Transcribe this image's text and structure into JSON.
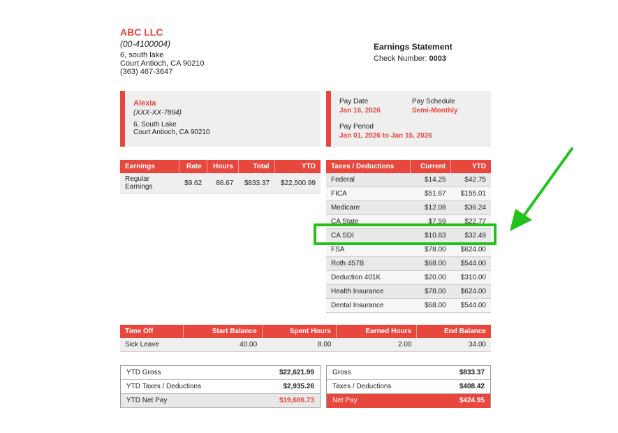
{
  "company": {
    "name": "ABC LLC",
    "id": "(00-4100004)",
    "address1": "6, south lake",
    "address2": "Court Antioch, CA 90210",
    "phone": "(363) 467-3647"
  },
  "statement": {
    "title": "Earnings Statement",
    "check_label": "Check Number:",
    "check_number": "0003"
  },
  "employee": {
    "name": "Alexia",
    "ssn": "(XXX-XX-7894)",
    "address1": "6, South Lake",
    "address2": "Court Antioch, CA 90210"
  },
  "pay_info": {
    "pay_date_label": "Pay Date",
    "pay_date": "Jan 16, 2026",
    "schedule_label": "Pay Schedule",
    "schedule": "Semi-Monthly",
    "period_label": "Pay Period",
    "period": "Jan 01, 2026 to Jan 15, 2026"
  },
  "earnings": {
    "headers": [
      "Earnings",
      "Rate",
      "Hours",
      "Total",
      "YTD"
    ],
    "rows": [
      {
        "name": "Regular Earnings",
        "rate": "$9.62",
        "hours": "86.67",
        "total": "$833.37",
        "ytd": "$22,500.99"
      }
    ]
  },
  "taxes": {
    "headers": [
      "Taxes / Deductions",
      "Current",
      "YTD"
    ],
    "rows": [
      {
        "name": "Federal",
        "current": "$14.25",
        "ytd": "$42.75"
      },
      {
        "name": "FICA",
        "current": "$51.67",
        "ytd": "$155.01"
      },
      {
        "name": "Medicare",
        "current": "$12.08",
        "ytd": "$36.24"
      },
      {
        "name": "CA State",
        "current": "$7.59",
        "ytd": "$22.77"
      },
      {
        "name": "CA SDI",
        "current": "$10.83",
        "ytd": "$32.49"
      },
      {
        "name": "FSA",
        "current": "$78.00",
        "ytd": "$624.00"
      },
      {
        "name": "Roth 457B",
        "current": "$68.00",
        "ytd": "$544.00"
      },
      {
        "name": "Deduction 401K",
        "current": "$20.00",
        "ytd": "$310.00"
      },
      {
        "name": "Health Insurance",
        "current": "$78.00",
        "ytd": "$624.00"
      },
      {
        "name": "Dental Insurance",
        "current": "$68.00",
        "ytd": "$544.00"
      }
    ]
  },
  "time_off": {
    "headers": [
      "Time Off",
      "Start Balance",
      "Spent Hours",
      "Earned Hours",
      "End Balance"
    ],
    "rows": [
      {
        "name": "Sick Leave",
        "start": "40.00",
        "spent": "8.00",
        "earned": "2.00",
        "end": "34.00"
      }
    ]
  },
  "ytd_summary": [
    {
      "label": "YTD Gross",
      "value": "$22,621.99"
    },
    {
      "label": "YTD Taxes / Deductions",
      "value": "$2,935.26"
    },
    {
      "label": "YTD Net Pay",
      "value": "$19,686.73"
    }
  ],
  "current_summary": [
    {
      "label": "Gross",
      "value": "$833.37"
    },
    {
      "label": "Taxes / Deductions",
      "value": "$408.42"
    },
    {
      "label": "Net Pay",
      "value": "$424.95"
    }
  ],
  "colors": {
    "accent": "#e8473e",
    "highlight": "#22c21b"
  },
  "annotation": {
    "icon": "green-arrow-icon",
    "highlighted_row": "CA SDI"
  }
}
